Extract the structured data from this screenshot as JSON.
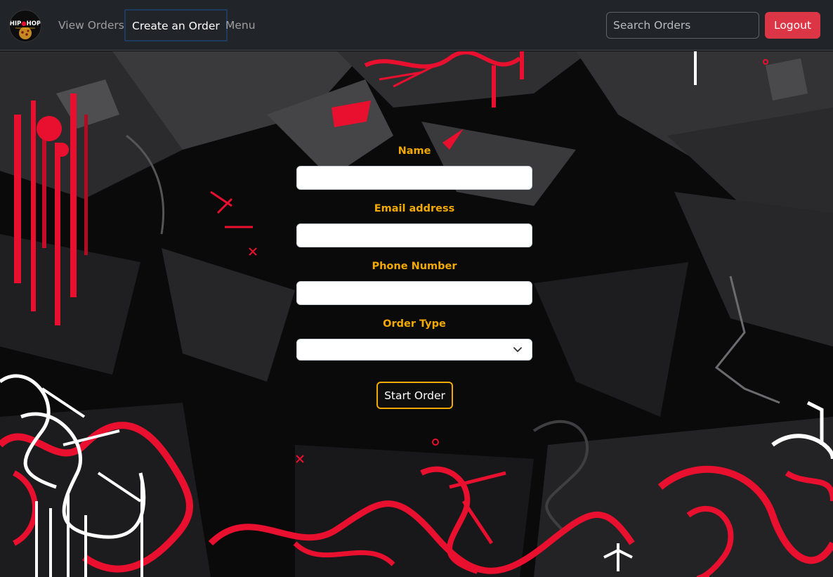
{
  "navbar": {
    "logo_text": "HIP HOP PIZZA AND WINGS",
    "links": [
      {
        "label": "View Orders"
      },
      {
        "label": "Create an Order"
      },
      {
        "label": "Menu"
      }
    ],
    "search": {
      "placeholder": "Search Orders",
      "value": ""
    },
    "logout_label": "Logout"
  },
  "form": {
    "name_label": "Name",
    "name_value": "",
    "email_label": "Email address",
    "email_value": "",
    "phone_label": "Phone Number",
    "phone_value": "",
    "order_type_label": "Order Type",
    "order_type_selected": "",
    "submit_label": "Start Order"
  },
  "colors": {
    "navbar_bg": "#212529",
    "label_accent": "#f2a900",
    "logout_bg": "#dc3545",
    "graffiti_red": "#e8102e"
  },
  "icons": {
    "logo": "hiphop-pizza-logo",
    "select_arrow": "chevron-down-icon"
  }
}
